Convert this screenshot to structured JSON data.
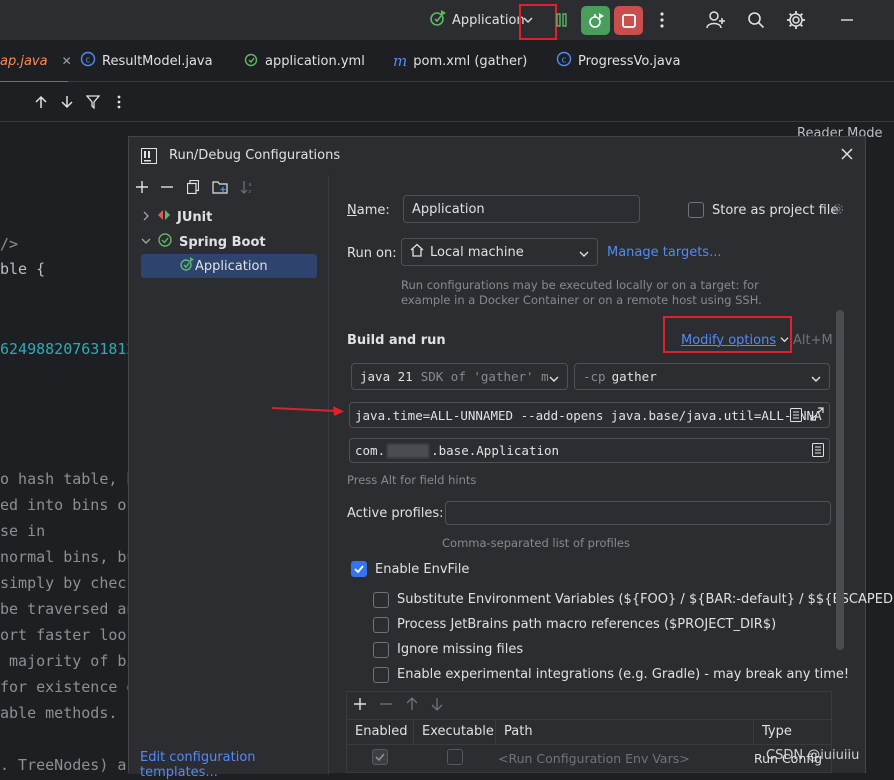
{
  "toolbar": {
    "run_config_label": "Application",
    "icons": [
      "spring-run-icon",
      "chevron-down-icon",
      "build-bars-icon",
      "debug-icon",
      "stop-icon",
      "more-vertical-icon",
      "add-user-icon",
      "search-icon",
      "gear-icon",
      "minimize-icon"
    ],
    "colors": {
      "debug": "#4a9e5c",
      "stop": "#c94f4f",
      "highlight": "#e0202a"
    }
  },
  "tabs": [
    {
      "label": "ap.java",
      "active": true
    },
    {
      "label": "ResultModel.java"
    },
    {
      "label": "application.yml"
    },
    {
      "label": "pom.xml (gather)"
    },
    {
      "label": "ProgressVo.java"
    }
  ],
  "editor": {
    "reader_mode": "Reader Mode",
    "lines": [
      {
        "text": "/>"
      },
      {
        "text": "ble {"
      },
      {
        "text": "624988207631812"
      },
      {
        "text": "o hash table, b"
      },
      {
        "text": "ed into bins of"
      },
      {
        "text": "se in"
      },
      {
        "text": "normal bins, bu"
      },
      {
        "text": "simply by check"
      },
      {
        "text": "be traversed an"
      },
      {
        "text": "ort faster look"
      },
      {
        "text": " majority of bi"
      },
      {
        "text": "for existence o"
      },
      {
        "text": "able methods."
      },
      {
        "text": ". TreeNodes) ar"
      }
    ]
  },
  "dialog": {
    "title": "Run/Debug Configurations",
    "tree": {
      "junit": "JUnit",
      "spring_boot": "Spring Boot",
      "application": "Application"
    },
    "footer_link": "Edit configuration templates...",
    "name_label": "Name:",
    "name_value": "Application",
    "store_label": "Store as project file",
    "run_on_label": "Run on:",
    "run_on_value": "Local machine",
    "manage_targets": "Manage targets...",
    "run_on_hint_1": "Run configurations may be executed locally or on a target: for",
    "run_on_hint_2": "example in a Docker Container or on a remote host using SSH.",
    "build_and_run": "Build and run",
    "modify_options": "Modify options",
    "modify_shortcut": "Alt+M",
    "jdk_value": "java 21",
    "jdk_hint": "SDK of 'gather' mc",
    "cp_prefix": "-cp",
    "cp_value": "gather",
    "vm_options": "java.time=ALL-UNNAMED --add-opens java.base/java.util=ALL-UNNA",
    "main_class_prefix": "com.",
    "main_class_suffix": ".base.Application",
    "press_alt_hint": "Press Alt for field hints",
    "active_profiles_label": "Active profiles:",
    "active_profiles_hint": "Comma-separated list of profiles",
    "enable_envfile": "Enable EnvFile",
    "substitute_env": "Substitute Environment Variables (${FOO} / ${BAR:-default} / $${ESCAPED})",
    "process_macro": "Process JetBrains path macro references ($PROJECT_DIR$)",
    "ignore_missing": "Ignore missing files",
    "experimental": "Enable experimental integrations (e.g. Gradle) - may break any time!",
    "table": {
      "headers": [
        "Enabled",
        "Executable",
        "Path",
        "Type"
      ],
      "row_path": "<Run Configuration Env Vars>",
      "row_type": "Run Config"
    }
  },
  "watermark": "CSDN @iuiuiiu"
}
